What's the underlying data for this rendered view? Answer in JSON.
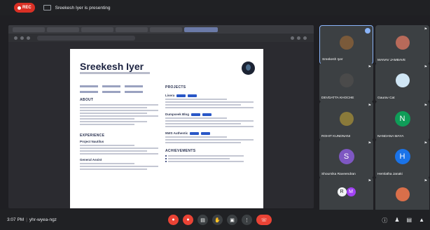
{
  "topbar": {
    "rec_label": "REC",
    "presenting_text": "Sreekesh Iyer is presenting"
  },
  "resume": {
    "name": "Sreekesh Iyer",
    "headings": {
      "about": "ABOUT",
      "experience": "EXPERIENCE",
      "projects": "PROJECTS",
      "achievements": "ACHIEVEMENTS"
    },
    "projects": [
      "Lisera",
      "Dumpseek Blog",
      "NWS Authentic"
    ],
    "experience": [
      "Project Nautilus",
      "General Assist"
    ]
  },
  "participants": [
    {
      "name": "Sreekesh Iyer",
      "kind": "photo",
      "color": "#7a5a3a",
      "active": true
    },
    {
      "name": "MANAV JAMBAVE",
      "kind": "photo",
      "color": "#b86a5a"
    },
    {
      "name": "DEVDATTA KHOCHE",
      "kind": "photo",
      "color": "#4a4a4a"
    },
    {
      "name": "Gaurav Cat",
      "kind": "photo",
      "color": "#d0e6f5"
    },
    {
      "name": "ROHIT KUNDNANI",
      "kind": "photo",
      "color": "#8a7a3a"
    },
    {
      "name": "NANDANA MAYA",
      "kind": "initial",
      "initial": "N",
      "color": "#0f9d58"
    },
    {
      "name": "Shoumika Raveendran",
      "kind": "initial",
      "initial": "S",
      "color": "#7e57c2"
    },
    {
      "name": "Hemlatha Janaki",
      "kind": "initial",
      "initial": "H",
      "color": "#1a73e8"
    },
    {
      "name": "21 others",
      "kind": "others"
    },
    {
      "name": "You",
      "kind": "photo",
      "color": "#d96f4a"
    }
  ],
  "others_initials": [
    "R",
    "M"
  ],
  "bottombar": {
    "time": "3:07 PM",
    "meeting_code": "yhr-wyea-ngz"
  }
}
